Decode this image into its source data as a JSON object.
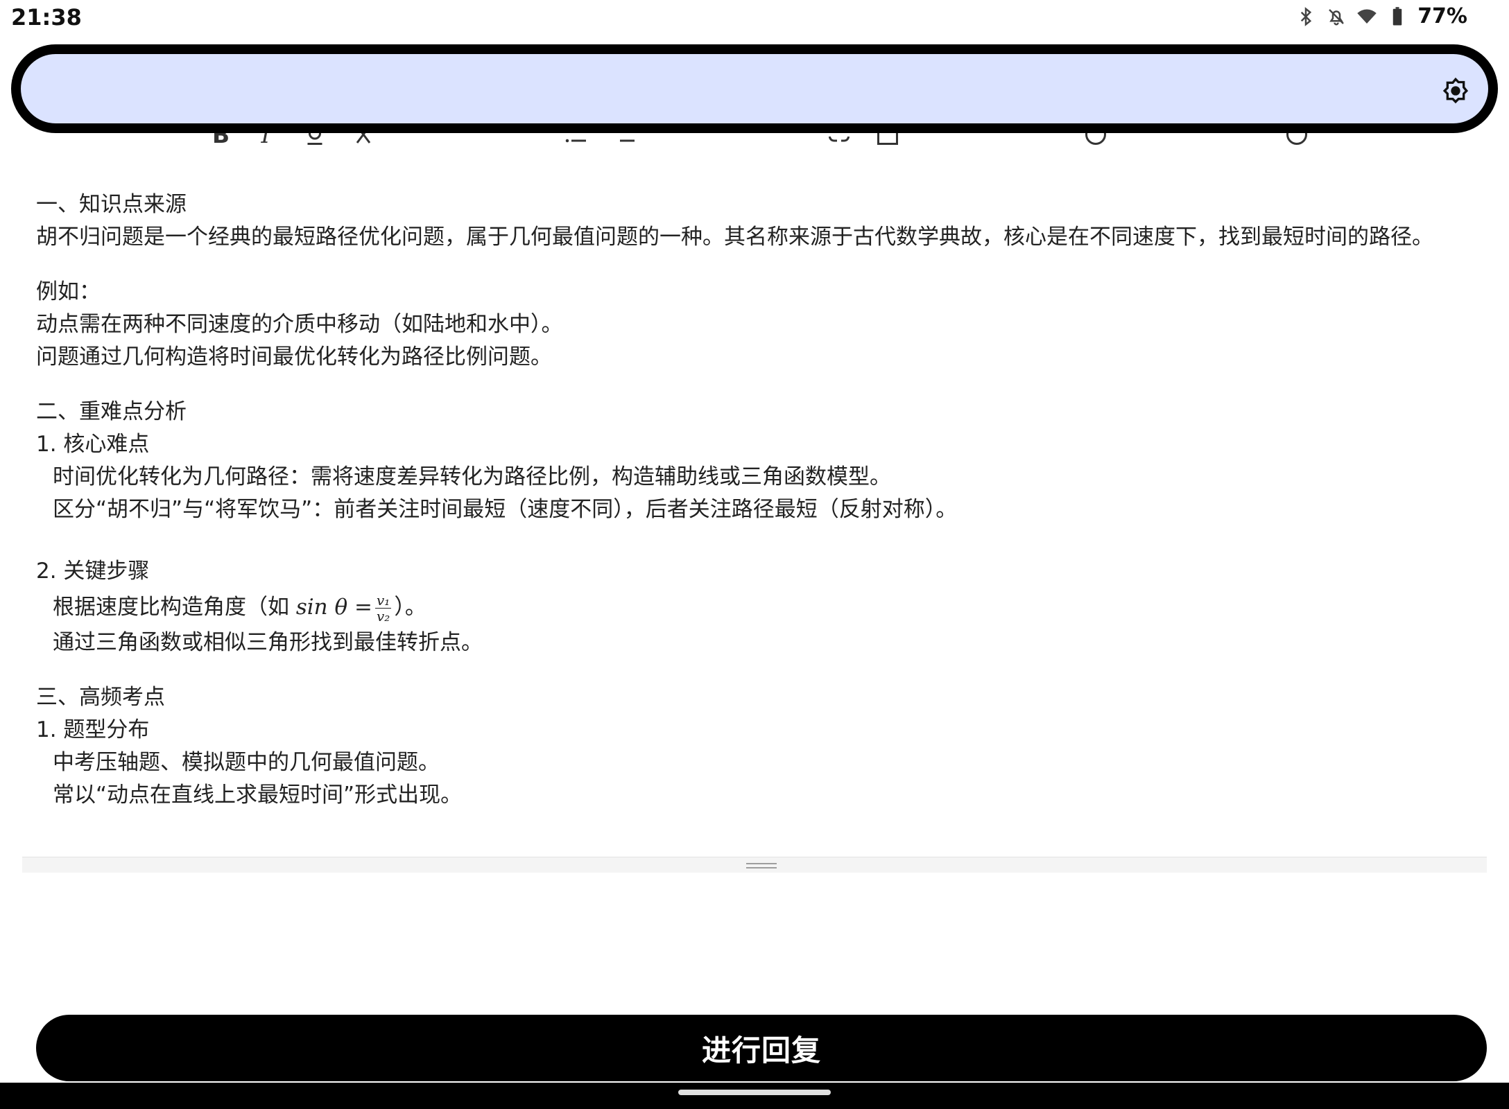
{
  "status_bar": {
    "time": "21:38",
    "battery": "77%",
    "icons": [
      "bluetooth-icon",
      "notifications-off-icon",
      "wifi-icon",
      "battery-icon"
    ]
  },
  "top_bar": {
    "background": "#dbe3ff",
    "settings_icon": "settings-brightness-icon"
  },
  "toolbar": {
    "icons": [
      "bold-icon",
      "italic-icon",
      "underline-icon",
      "strikethrough-icon",
      "bullet-list-icon",
      "numbered-list-icon",
      "link-icon",
      "image-icon",
      "emoji-icon",
      "mention-icon"
    ]
  },
  "content": {
    "s1_heading": "一、知识点来源",
    "s1_p1": "胡不归问题是一个经典的最短路径优化问题，属于几何最值问题的一种。其名称来源于古代数学典故，核心是在不同速度下，找到最短时间的路径。",
    "s1_example_label": "例如：",
    "s1_example_1": "动点需在两种不同速度的介质中移动（如陆地和水中）。",
    "s1_example_2": "问题通过几何构造将时间最优化转化为路径比例问题。",
    "s2_heading": "二、重难点分析",
    "s2_sub1": "1. 核心难点",
    "s2_sub1_item1": "时间优化转化为几何路径：需将速度差异转化为路径比例，构造辅助线或三角函数模型。",
    "s2_sub1_item2": "区分“胡不归”与“将军饮马”：前者关注时间最短（速度不同），后者关注路径最短（反射对称）。",
    "s2_sub2": "2. 关键步骤",
    "s2_sub2_item1_pre": "根据速度比构造角度（如 ",
    "s2_sub2_item1_math": "sin θ =",
    "s2_sub2_item1_num": "v₁",
    "s2_sub2_item1_den": "v₂",
    "s2_sub2_item1_post": "）。",
    "s2_sub2_item2": "通过三角函数或相似三角形找到最佳转折点。",
    "s3_heading": "三、高频考点",
    "s3_sub1": "1. 题型分布",
    "s3_sub1_item1": "中考压轴题、模拟题中的几何最值问题。",
    "s3_sub1_item2": "常以“动点在直线上求最短时间”形式出现。"
  },
  "reply_button": {
    "label": "进行回复"
  }
}
